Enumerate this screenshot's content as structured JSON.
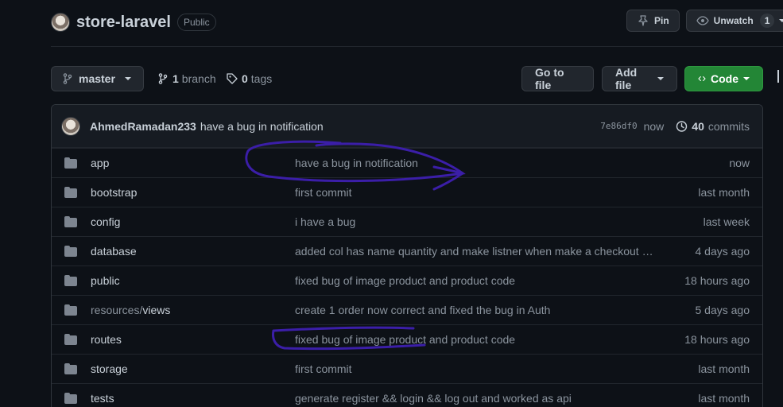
{
  "repo": {
    "name": "store-laravel",
    "visibility": "Public"
  },
  "header_actions": {
    "pin_label": "Pin",
    "unwatch_label": "Unwatch",
    "watch_count": "1"
  },
  "toolbar": {
    "branch_name": "master",
    "branches_count": "1",
    "branches_label": "branch",
    "tags_count": "0",
    "tags_label": "tags",
    "go_to_file": "Go to file",
    "add_file": "Add file",
    "code": "Code"
  },
  "latest_commit": {
    "author": "AhmedRamadan233",
    "message": "have a bug in notification",
    "sha": "7e86df0",
    "time": "now",
    "commit_count": "40",
    "commits_label": "commits"
  },
  "files": [
    {
      "name": "app",
      "message": "have a bug in notification",
      "age": "now"
    },
    {
      "name": "bootstrap",
      "message": "first commit",
      "age": "last month"
    },
    {
      "name": "config",
      "message": "i have a bug",
      "age": "last week"
    },
    {
      "name": "database",
      "message": "added col has name quantity and make listner when make a checkout t…",
      "age": "4 days ago"
    },
    {
      "name": "public",
      "message": "fixed bug of image product and product code",
      "age": "18 hours ago"
    },
    {
      "name_prefix": "resources/",
      "name": "views",
      "message": "create 1 order now correct and fixed the bug in Auth",
      "age": "5 days ago"
    },
    {
      "name": "routes",
      "message": "fixed bug of image product and product code",
      "age": "18 hours ago"
    },
    {
      "name": "storage",
      "message": "first commit",
      "age": "last month"
    },
    {
      "name": "tests",
      "message": "generate register && login && log out and worked as api",
      "age": "last month"
    }
  ],
  "colors": {
    "background": "#0d1117",
    "accent_green": "#238636",
    "annotation_ink": "#3b1ea8"
  },
  "icons": [
    "repo-avatar",
    "pin-icon",
    "eye-icon",
    "git-branch-icon",
    "tag-icon",
    "code-icon",
    "history-icon",
    "folder-icon"
  ]
}
